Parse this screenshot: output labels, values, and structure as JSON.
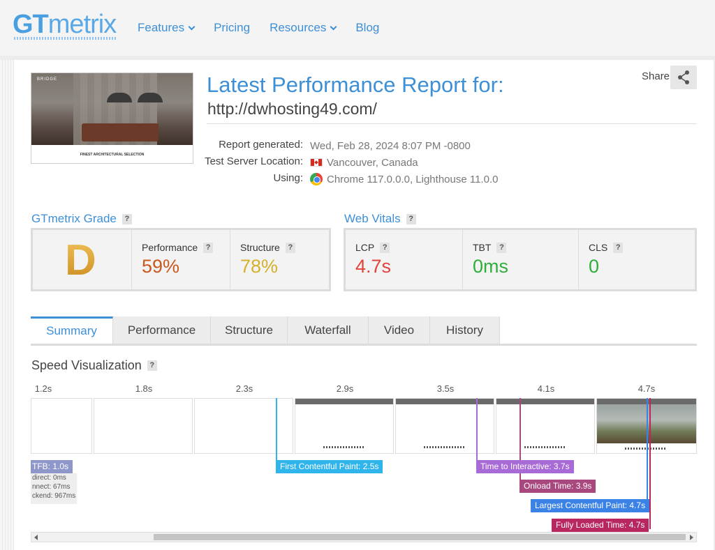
{
  "header": {
    "logo_gt": "GT",
    "logo_metrix": "metrix",
    "nav": [
      {
        "label": "Features",
        "has_dropdown": true
      },
      {
        "label": "Pricing",
        "has_dropdown": false
      },
      {
        "label": "Resources",
        "has_dropdown": true
      },
      {
        "label": "Blog",
        "has_dropdown": false
      }
    ]
  },
  "report": {
    "title": "Latest Performance Report for:",
    "url": "http://dwhosting49.com/",
    "share_label": "Share",
    "thumbnail": {
      "brand": "BRIDGE",
      "caption": "FINEST ARCHITECTURAL SELECTION"
    },
    "meta": [
      {
        "label": "Report generated:",
        "value": "Wed, Feb 28, 2024 8:07 PM -0800",
        "icon": null
      },
      {
        "label": "Test Server Location:",
        "value": "Vancouver, Canada",
        "icon": "canada-flag-icon"
      },
      {
        "label": "Using:",
        "value": "Chrome 117.0.0.0, Lighthouse 11.0.0",
        "icon": "chrome-icon"
      }
    ]
  },
  "grade": {
    "heading": "GTmetrix Grade",
    "letter": "D",
    "performance_label": "Performance",
    "performance_value": "59%",
    "structure_label": "Structure",
    "structure_value": "78%"
  },
  "vitals": {
    "heading": "Web Vitals",
    "items": [
      {
        "label": "LCP",
        "value": "4.7s",
        "color": "#e2433b"
      },
      {
        "label": "TBT",
        "value": "0ms",
        "color": "#2fae3c"
      },
      {
        "label": "CLS",
        "value": "0",
        "color": "#2fae3c"
      }
    ]
  },
  "tabs": [
    "Summary",
    "Performance",
    "Structure",
    "Waterfall",
    "Video",
    "History"
  ],
  "active_tab": "Summary",
  "speed": {
    "heading": "Speed Visualization",
    "ticks": [
      "1.2s",
      "1.8s",
      "2.3s",
      "2.9s",
      "3.5s",
      "4.1s",
      "4.7s"
    ],
    "markers": {
      "ttfb": "TFB: 1.0s",
      "ttfb_details": [
        "direct: 0ms",
        "nnect: 67ms",
        "ckend: 967ms"
      ],
      "fcp": "First Contentful Paint: 2.5s",
      "tti": "Time to Interactive: 3.7s",
      "onload": "Onload Time: 3.9s",
      "lcp": "Largest Contentful Paint: 4.7s",
      "fully_loaded": "Fully Loaded Time: 4.7s"
    },
    "colors": {
      "ttfb": "#8d97c9",
      "fcp": "#2fb4ec",
      "tti": "#a86ad6",
      "onload": "#a9477f",
      "lcp": "#3b82e6",
      "fully_loaded": "#b8275f"
    }
  }
}
